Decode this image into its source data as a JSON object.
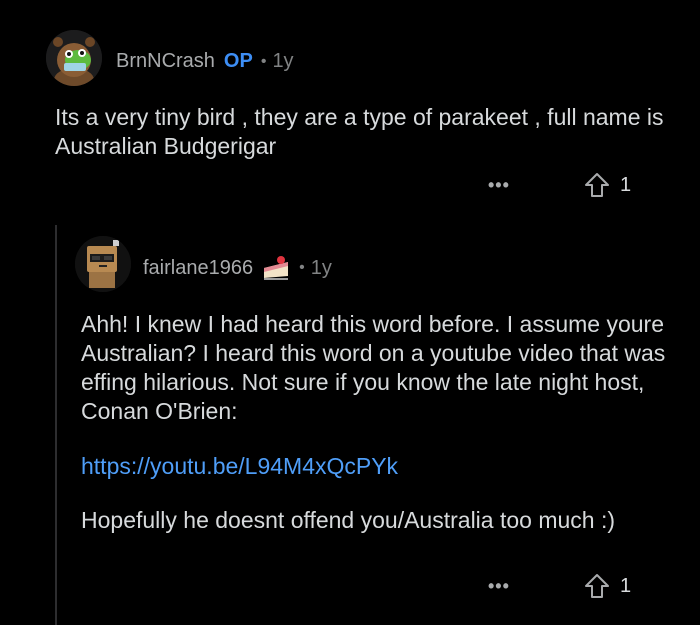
{
  "comments": [
    {
      "username": "BrnNCrash",
      "op_badge": "OP",
      "age": "1y",
      "body": "Its a very tiny bird , they are a type of parakeet , full name is Australian Budgerigar",
      "more_label": "•••",
      "upvotes": "1"
    },
    {
      "username": "fairlane1966",
      "age": "1y",
      "body_p1": "Ahh!  I knew I had heard this word before.  I assume youre Australian?  I heard this word on a youtube video that was effing hilarious.  Not sure if you know the late night host, Conan O'Brien:",
      "link": "https://youtu.be/L94M4xQcPYk",
      "body_p2": "Hopefully he doesnt offend you/Australia too much :)",
      "more_label": "•••",
      "upvotes": "1"
    }
  ],
  "colors": {
    "background": "#000000",
    "text": "#d7dadc",
    "meta": "#818384",
    "op_accent": "#3d8ef5",
    "link": "#4f9ef8"
  },
  "icons": {
    "upvote": "upvote-arrow-icon",
    "more": "more-options-icon"
  }
}
